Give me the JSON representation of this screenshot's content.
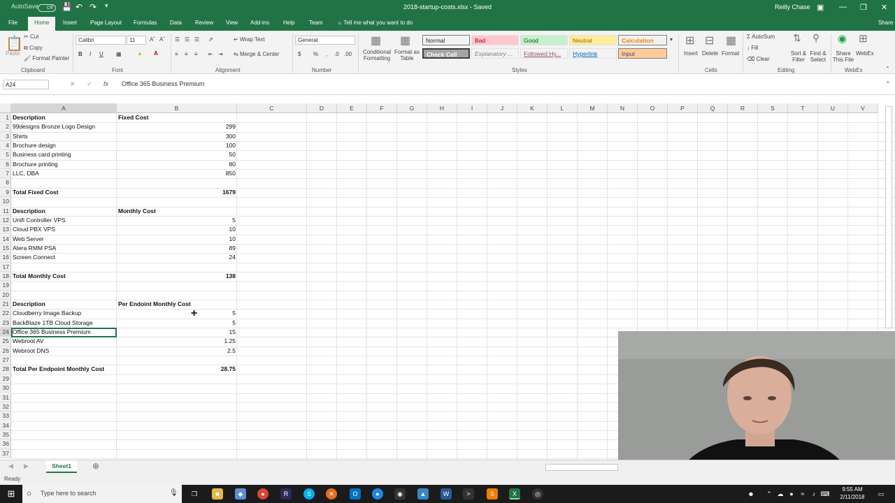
{
  "titlebar": {
    "autosave": "AutoSave",
    "toggle": "Off",
    "document_title": "2018-startup-costs.xlsx - Saved",
    "user": "Reilly Chase"
  },
  "tabs": [
    "File",
    "Home",
    "Insert",
    "Page Layout",
    "Formulas",
    "Data",
    "Review",
    "View",
    "Add-ins",
    "Help",
    "Team"
  ],
  "tell_me": "Tell me what you want to do",
  "share": "Share",
  "ribbon": {
    "clipboard": {
      "paste": "Paste",
      "cut": "Cut",
      "copy": "Copy",
      "format_painter": "Format Painter",
      "label": "Clipboard"
    },
    "font": {
      "name": "Calibri",
      "size": "11",
      "label": "Font"
    },
    "alignment": {
      "wrap": "Wrap Text",
      "merge": "Merge & Center",
      "label": "Alignment"
    },
    "number": {
      "format": "General",
      "label": "Number"
    },
    "styles": {
      "conditional": "Conditional Formatting",
      "format_table": "Format as Table",
      "cells": [
        {
          "label": "Normal",
          "bg": "#ffffff",
          "color": "#000000"
        },
        {
          "label": "Bad",
          "bg": "#ffc7ce",
          "color": "#9c0006"
        },
        {
          "label": "Good",
          "bg": "#c6efce",
          "color": "#006100"
        },
        {
          "label": "Neutral",
          "bg": "#ffeb9c",
          "color": "#9c6500"
        },
        {
          "label": "Calculation",
          "bg": "#f2f2f2",
          "color": "#fa7d00"
        },
        {
          "label": "Check Cell",
          "bg": "#a5a5a5",
          "color": "#ffffff"
        },
        {
          "label": "Explanatory ...",
          "bg": "#ffffff",
          "color": "#7f7f7f"
        },
        {
          "label": "Followed Hy...",
          "bg": "#ffffff",
          "color": "#954f72"
        },
        {
          "label": "Hyperlink",
          "bg": "#ffffff",
          "color": "#0563c1"
        },
        {
          "label": "Input",
          "bg": "#ffcc99",
          "color": "#3f3f76"
        }
      ],
      "label": "Styles"
    },
    "cells": {
      "insert": "Insert",
      "delete": "Delete",
      "format": "Format",
      "label": "Cells"
    },
    "editing": {
      "autosum": "AutoSum",
      "fill": "Fill",
      "clear": "Clear",
      "sort": "Sort & Filter",
      "find": "Find & Select",
      "label": "Editing"
    },
    "webex": {
      "share": "Share This File",
      "webex": "WebEx",
      "label": "WebEx"
    }
  },
  "formula_bar": {
    "name_box": "A24",
    "content": "Office 365 Business Premium",
    "fx": "fx"
  },
  "columns": [
    "A",
    "B",
    "C",
    "D",
    "E",
    "F",
    "G",
    "H",
    "I",
    "J",
    "K",
    "L",
    "M",
    "N",
    "O",
    "P",
    "Q",
    "R",
    "S",
    "T",
    "U",
    "V"
  ],
  "rows": [
    {
      "n": "1",
      "a": "Description",
      "b": "Fixed Cost",
      "bold": true,
      "b_text": true
    },
    {
      "n": "2",
      "a": "99designs Bronze Logo Design",
      "b": "299"
    },
    {
      "n": "3",
      "a": "Shirts",
      "b": "300"
    },
    {
      "n": "4",
      "a": "Brochure design",
      "b": "100"
    },
    {
      "n": "5",
      "a": "Business card printing",
      "b": "50"
    },
    {
      "n": "6",
      "a": "Brochure printing",
      "b": "80"
    },
    {
      "n": "7",
      "a": "LLC, DBA",
      "b": "850"
    },
    {
      "n": "8",
      "a": "",
      "b": ""
    },
    {
      "n": "9",
      "a": "Total Fixed Cost",
      "b": "1679",
      "bold": true
    },
    {
      "n": "10",
      "a": "",
      "b": ""
    },
    {
      "n": "11",
      "a": "Description",
      "b": "Monthly Cost",
      "bold": true,
      "b_text": true
    },
    {
      "n": "12",
      "a": "Unifi Controller VPS",
      "b": "5"
    },
    {
      "n": "13",
      "a": "Cloud PBX VPS",
      "b": "10"
    },
    {
      "n": "14",
      "a": "Web Server",
      "b": "10"
    },
    {
      "n": "15",
      "a": "Atera RMM PSA",
      "b": "89"
    },
    {
      "n": "16",
      "a": "Screen Connect",
      "b": "24"
    },
    {
      "n": "17",
      "a": "",
      "b": ""
    },
    {
      "n": "18",
      "a": "Total Monthly Cost",
      "b": "138",
      "bold": true
    },
    {
      "n": "19",
      "a": "",
      "b": ""
    },
    {
      "n": "20",
      "a": "",
      "b": ""
    },
    {
      "n": "21",
      "a": "Description",
      "b": "Per Endoint Monthly Cost",
      "bold": true,
      "b_text": true
    },
    {
      "n": "22",
      "a": "Cloudberry Image Backup",
      "b": "5"
    },
    {
      "n": "23",
      "a": "BackBlaze 1TB Cloud Storage",
      "b": "5"
    },
    {
      "n": "24",
      "a": "Office 365 Business Premium",
      "b": "15"
    },
    {
      "n": "25",
      "a": "Webroot AV",
      "b": "1.25"
    },
    {
      "n": "26",
      "a": "Webroot DNS",
      "b": "2.5"
    },
    {
      "n": "27",
      "a": "",
      "b": ""
    },
    {
      "n": "28",
      "a": "Total Per Endpoint Monthly Cost",
      "b": "28.75",
      "bold": true
    },
    {
      "n": "29",
      "a": "",
      "b": ""
    },
    {
      "n": "30",
      "a": "",
      "b": ""
    },
    {
      "n": "31",
      "a": "",
      "b": ""
    },
    {
      "n": "32",
      "a": "",
      "b": ""
    },
    {
      "n": "33",
      "a": "",
      "b": ""
    },
    {
      "n": "34",
      "a": "",
      "b": ""
    },
    {
      "n": "35",
      "a": "",
      "b": ""
    },
    {
      "n": "36",
      "a": "",
      "b": ""
    },
    {
      "n": "37",
      "a": "",
      "b": ""
    }
  ],
  "sheet_tab": "Sheet1",
  "status": "Ready",
  "taskbar": {
    "search": "Type here to search",
    "time": "9:55 AM",
    "date": "2/11/2018"
  },
  "colors": {
    "excel_green": "#217346",
    "taskbar": "#1b1b1b"
  }
}
